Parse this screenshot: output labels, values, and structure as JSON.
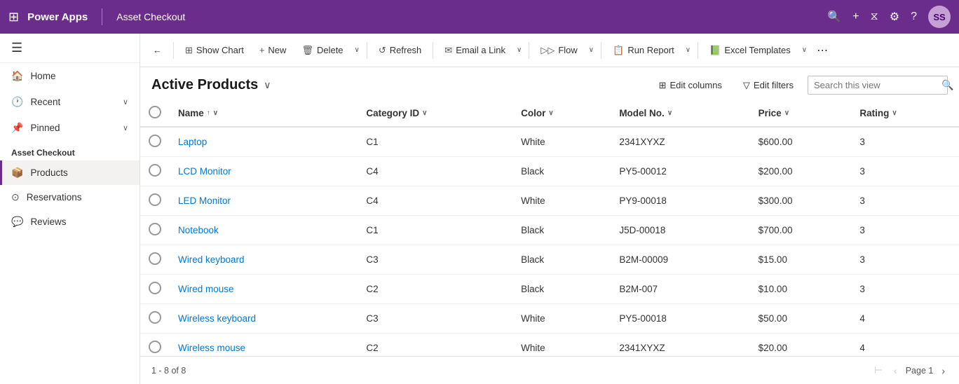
{
  "topNav": {
    "appTitle": "Power Apps",
    "appName": "Asset Checkout",
    "icons": {
      "waffle": "⊞",
      "search": "🔍",
      "add": "+",
      "filter": "⧖",
      "settings": "⚙",
      "help": "?",
      "avatar": "SS"
    }
  },
  "sidebar": {
    "toggleIcon": "☰",
    "navItems": [
      {
        "icon": "🏠",
        "label": "Home",
        "hasArrow": false
      },
      {
        "icon": "🕐",
        "label": "Recent",
        "hasArrow": true
      },
      {
        "icon": "📌",
        "label": "Pinned",
        "hasArrow": true
      }
    ],
    "sectionLabel": "Asset Checkout",
    "appNavItems": [
      {
        "icon": "📦",
        "label": "Products",
        "active": true
      },
      {
        "icon": "⊙",
        "label": "Reservations",
        "active": false
      },
      {
        "icon": "💬",
        "label": "Reviews",
        "active": false
      }
    ]
  },
  "toolbar": {
    "backIcon": "←",
    "buttons": [
      {
        "key": "show-chart",
        "icon": "📊",
        "label": "Show Chart",
        "hasDropdown": false
      },
      {
        "key": "new",
        "icon": "+",
        "label": "New",
        "hasDropdown": false
      },
      {
        "key": "delete",
        "icon": "🗑",
        "label": "Delete",
        "hasDropdown": true
      },
      {
        "key": "refresh",
        "icon": "↺",
        "label": "Refresh",
        "hasDropdown": false
      },
      {
        "key": "email-link",
        "icon": "✉",
        "label": "Email a Link",
        "hasDropdown": true
      },
      {
        "key": "flow",
        "icon": "▷▷",
        "label": "Flow",
        "hasDropdown": true
      },
      {
        "key": "run-report",
        "icon": "📋",
        "label": "Run Report",
        "hasDropdown": true
      },
      {
        "key": "excel-templates",
        "icon": "📗",
        "label": "Excel Templates",
        "hasDropdown": true
      }
    ],
    "moreIcon": "⋯"
  },
  "viewHeader": {
    "title": "Active Products",
    "dropdownIcon": "∨",
    "editColumns": "Edit columns",
    "editFilters": "Edit filters",
    "searchPlaceholder": "Search this view",
    "columnsIcon": "⊞",
    "filtersIcon": "▽",
    "searchIcon": "🔍"
  },
  "table": {
    "columns": [
      {
        "key": "name",
        "label": "Name",
        "sortable": true,
        "sorted": "asc"
      },
      {
        "key": "categoryId",
        "label": "Category ID",
        "sortable": true
      },
      {
        "key": "color",
        "label": "Color",
        "sortable": true
      },
      {
        "key": "modelNo",
        "label": "Model No.",
        "sortable": true
      },
      {
        "key": "price",
        "label": "Price",
        "sortable": true
      },
      {
        "key": "rating",
        "label": "Rating",
        "sortable": true
      }
    ],
    "rows": [
      {
        "name": "Laptop",
        "categoryId": "C1",
        "color": "White",
        "modelNo": "2341XYXZ",
        "price": "$600.00",
        "rating": "3"
      },
      {
        "name": "LCD Monitor",
        "categoryId": "C4",
        "color": "Black",
        "modelNo": "PY5-00012",
        "price": "$200.00",
        "rating": "3"
      },
      {
        "name": "LED Monitor",
        "categoryId": "C4",
        "color": "White",
        "modelNo": "PY9-00018",
        "price": "$300.00",
        "rating": "3"
      },
      {
        "name": "Notebook",
        "categoryId": "C1",
        "color": "Black",
        "modelNo": "J5D-00018",
        "price": "$700.00",
        "rating": "3"
      },
      {
        "name": "Wired keyboard",
        "categoryId": "C3",
        "color": "Black",
        "modelNo": "B2M-00009",
        "price": "$15.00",
        "rating": "3"
      },
      {
        "name": "Wired mouse",
        "categoryId": "C2",
        "color": "Black",
        "modelNo": "B2M-007",
        "price": "$10.00",
        "rating": "3"
      },
      {
        "name": "Wireless keyboard",
        "categoryId": "C3",
        "color": "White",
        "modelNo": "PY5-00018",
        "price": "$50.00",
        "rating": "4"
      },
      {
        "name": "Wireless mouse",
        "categoryId": "C2",
        "color": "White",
        "modelNo": "2341XYXZ",
        "price": "$20.00",
        "rating": "4"
      }
    ]
  },
  "footer": {
    "rangeText": "1 - 8 of 8",
    "pageLabel": "Page 1",
    "firstIcon": "⊢",
    "prevIcon": "‹",
    "nextIcon": "›",
    "lastIcon": "⊣"
  }
}
